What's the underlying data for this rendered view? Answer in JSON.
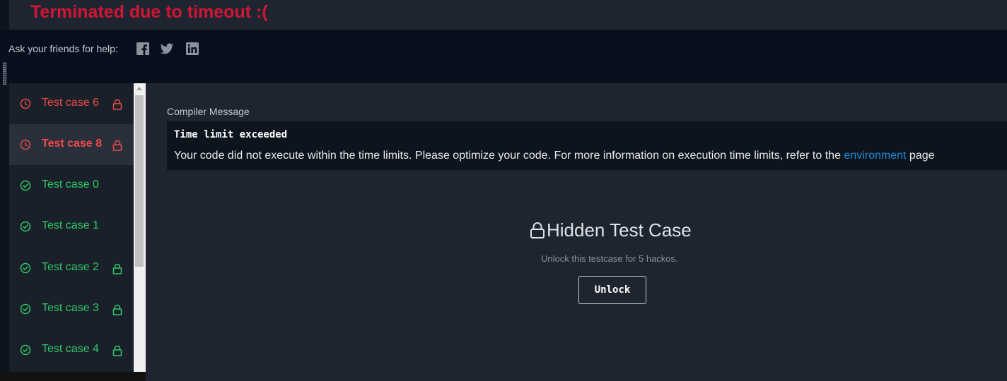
{
  "status": {
    "title": "Terminated due to timeout :("
  },
  "share": {
    "label": "Ask your friends for help:",
    "icons": [
      "facebook-icon",
      "twitter-icon",
      "linkedin-icon"
    ]
  },
  "sidebar": {
    "items": [
      {
        "label": "Test case 6",
        "result": "timeout",
        "locked": true,
        "active": false
      },
      {
        "label": "Test case 8",
        "result": "timeout",
        "locked": true,
        "active": true
      },
      {
        "label": "Test case 0",
        "result": "passed",
        "locked": false,
        "active": false
      },
      {
        "label": "Test case 1",
        "result": "passed",
        "locked": false,
        "active": false
      },
      {
        "label": "Test case 2",
        "result": "passed",
        "locked": true,
        "active": false
      },
      {
        "label": "Test case 3",
        "result": "passed",
        "locked": true,
        "active": false
      },
      {
        "label": "Test case 4",
        "result": "passed",
        "locked": true,
        "active": false
      }
    ]
  },
  "compiler": {
    "label": "Compiler Message",
    "heading": "Time limit exceeded",
    "message": "Your code did not execute within the time limits. Please optimize your code. For more information on execution time limits, refer to the",
    "link_text": "environment",
    "suffix": "page"
  },
  "hidden": {
    "title": "Hidden Test Case",
    "subtitle": "Unlock this testcase for 5 hackos.",
    "button_label": "Unlock"
  },
  "colors": {
    "error": "#d11534",
    "fail": "#ec4a48",
    "pass": "#2ec866",
    "link": "#1a8cd8"
  }
}
